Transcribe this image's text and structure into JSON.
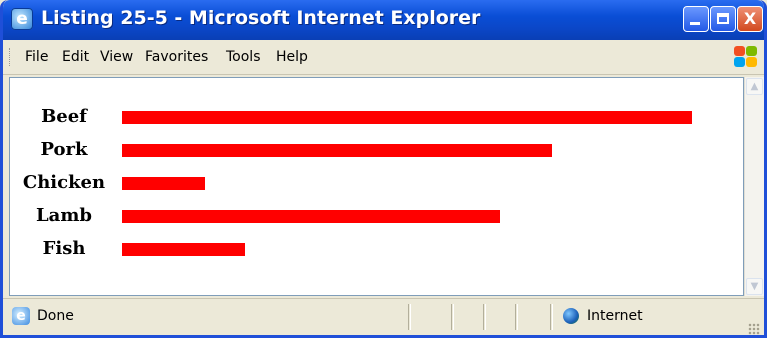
{
  "window": {
    "title": "Listing 25-5 - Microsoft Internet Explorer",
    "minimize_label": "",
    "maximize_label": "",
    "close_label": "X"
  },
  "menu": {
    "items": [
      "File",
      "Edit",
      "View",
      "Favorites",
      "Tools",
      "Help"
    ]
  },
  "chart_data": {
    "type": "bar",
    "orientation": "horizontal",
    "categories": [
      "Beef",
      "Pork",
      "Chicken",
      "Lamb",
      "Fish"
    ],
    "values": [
      100,
      75.5,
      14.5,
      66.3,
      21.5
    ],
    "color": "#ff0000",
    "title": "",
    "xlabel": "",
    "ylabel": ""
  },
  "status": {
    "text": "Done",
    "zone": "Internet"
  },
  "colors": {
    "titlebar": "#0a4ed6",
    "bar": "#ff0000",
    "chrome": "#ece9d8"
  }
}
